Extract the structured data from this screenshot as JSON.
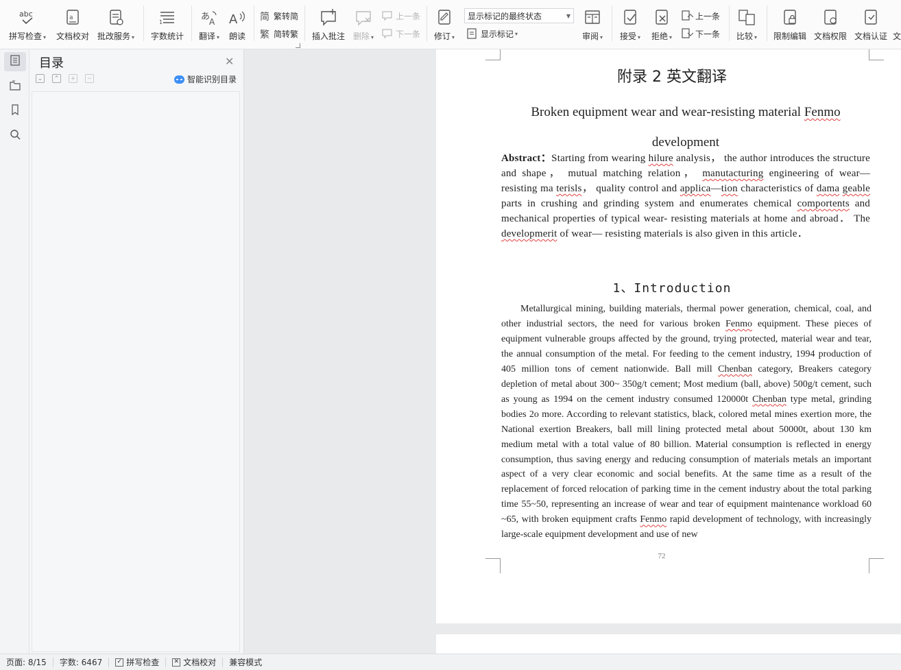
{
  "toolbar": {
    "spell_check": "拼写检查",
    "doc_proof": "文档校对",
    "review_service": "批改服务",
    "word_count": "字数统计",
    "translate": "翻译",
    "read_aloud": "朗读",
    "trad_to_simp": "繁转简",
    "simp_to_trad": "简转繁",
    "insert_comment": "插入批注",
    "delete": "删除",
    "prev": "上一条",
    "next": "下一条",
    "track_changes": "修订",
    "markup_state": "显示标记的最终状态",
    "show_markup": "显示标记",
    "review": "审阅",
    "accept": "接受",
    "reject": "拒绝",
    "prev2": "上一条",
    "next2": "下一条",
    "compare": "比较",
    "restrict_edit": "限制编辑",
    "doc_permission": "文档权限",
    "doc_cert": "文档认证",
    "overflow": "文"
  },
  "toc": {
    "title": "目录",
    "ai_detect": "智能识别目录"
  },
  "document": {
    "heading": "附录 2 英文翻译",
    "title_line1": "Broken equipment wear and wear-resisting material",
    "title_fenmo": "Fenmo",
    "title_line2": "development",
    "section_heading": "1、Introduction",
    "page_number": "72"
  },
  "status": {
    "page": "页面: 8/15",
    "words": "字数: 6467",
    "spell_check": "拼写检查",
    "doc_proof": "文档校对",
    "compat_mode": "兼容模式"
  }
}
